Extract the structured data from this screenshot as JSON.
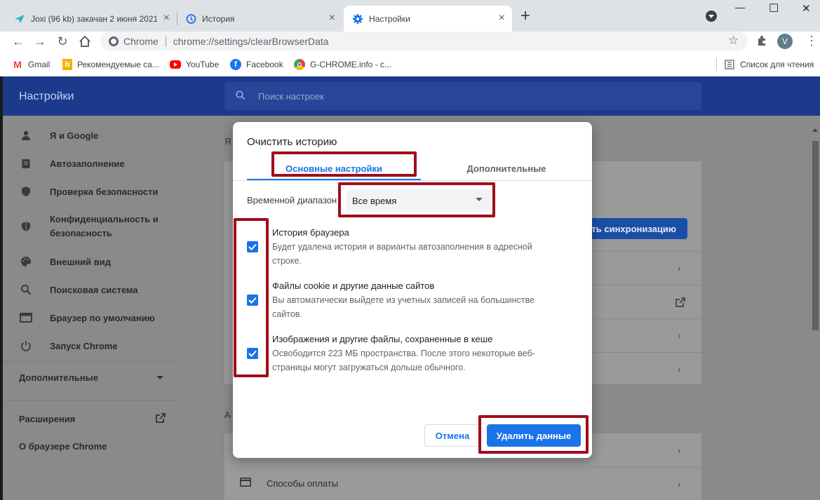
{
  "tabs": [
    {
      "label": "Joxi (96 kb) закачан 2 июня 2021",
      "icon": "joxi-icon"
    },
    {
      "label": "История",
      "icon": "history-icon"
    },
    {
      "label": "Настройки",
      "icon": "gear-icon"
    }
  ],
  "new_tab": "+",
  "window_controls": {
    "minimize": "—",
    "maximize": "☐",
    "close": "✕"
  },
  "omnibox": {
    "site": "Chrome",
    "url": "chrome://settings/clearBrowserData"
  },
  "profile_initial": "V",
  "bookmarks": [
    {
      "label": "Gmail",
      "icon": "gmail-icon"
    },
    {
      "label": "Рекомендуемые са...",
      "icon": "bing-icon"
    },
    {
      "label": "YouTube",
      "icon": "youtube-icon"
    },
    {
      "label": "Facebook",
      "icon": "facebook-icon"
    },
    {
      "label": "G-CHROME.info - с...",
      "icon": "chrome-icon"
    }
  ],
  "reading_list": "Список для чтения",
  "settings": {
    "title": "Настройки",
    "search_placeholder": "Поиск настроек"
  },
  "sidebar": {
    "items": [
      {
        "label": "Я и Google",
        "icon": "person-icon"
      },
      {
        "label": "Автозаполнение",
        "icon": "clipboard-icon"
      },
      {
        "label": "Проверка безопасности",
        "icon": "shield-icon"
      },
      {
        "label": "Конфиденциальность и",
        "label2": "безопасность",
        "icon": "shield-lock-icon"
      },
      {
        "label": "Внешний вид",
        "icon": "palette-icon"
      },
      {
        "label": "Поисковая система",
        "icon": "search-icon"
      },
      {
        "label": "Браузер по умолчанию",
        "icon": "browser-icon"
      },
      {
        "label": "Запуск Chrome",
        "icon": "power-icon"
      }
    ],
    "advanced": "Дополнительные",
    "extensions": "Расширения",
    "about": "О браузере Chrome"
  },
  "behind": {
    "section_letter_1": "Я",
    "sync_button": "ить синхронизацию",
    "section_letter_2": "А",
    "payment": "Способы оплаты"
  },
  "dialog": {
    "title": "Очистить историю",
    "tab_basic": "Основные настройки",
    "tab_advanced": "Дополнительные",
    "range_label": "Временной диапазон",
    "range_value": "Все время",
    "options": [
      {
        "title": "История браузера",
        "desc": "Будет удалена история и варианты автозаполнения в адресной строке.",
        "checked": true
      },
      {
        "title": "Файлы cookie и другие данные сайтов",
        "desc": "Вы автоматически выйдете из учетных записей на большинстве сайтов.",
        "checked": true
      },
      {
        "title": "Изображения и другие файлы, сохраненные в кеше",
        "desc": "Освободится 223 МБ пространства. После этого некоторые веб-страницы могут загружаться дольше обычного.",
        "checked": true
      }
    ],
    "cancel": "Отмена",
    "delete": "Удалить данные"
  },
  "colors": {
    "accent": "#1a73e8",
    "header": "#1b3a8c",
    "highlight": "#a00d1a"
  }
}
